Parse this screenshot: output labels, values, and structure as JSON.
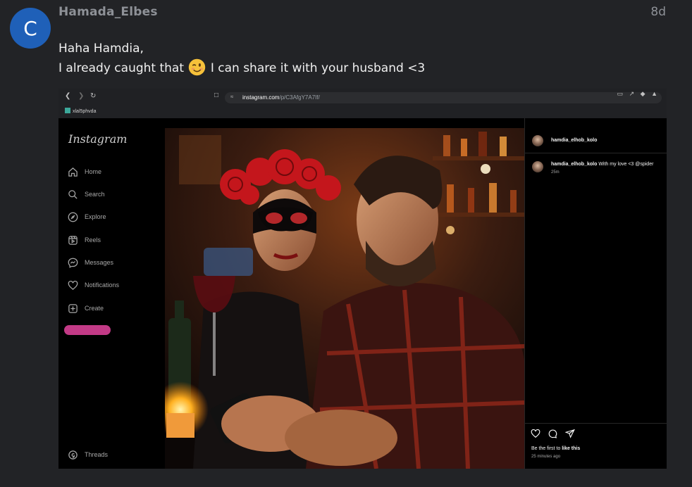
{
  "post": {
    "avatar_letter": "C",
    "username": "Hamada_Elbes",
    "age": "8d",
    "line1": "Haha Hamdia,",
    "line2_before": "I already caught that",
    "emoji": "winking-face",
    "line2_after": "I can share it with your husband <3"
  },
  "screenshot": {
    "url_host": "instagram.com",
    "url_path": "/p/C3AfgY7A7If/",
    "bookmark": "xlal5phvda",
    "logo": "Instagram",
    "nav": [
      {
        "label": "Home",
        "icon": "home-icon"
      },
      {
        "label": "Search",
        "icon": "search-icon"
      },
      {
        "label": "Explore",
        "icon": "compass-icon"
      },
      {
        "label": "Reels",
        "icon": "reels-icon"
      },
      {
        "label": "Messages",
        "icon": "messenger-icon"
      },
      {
        "label": "Notifications",
        "icon": "heart-icon"
      },
      {
        "label": "Create",
        "icon": "plus-icon"
      }
    ],
    "threads": "Threads",
    "panel": {
      "username": "hamdia_elhob_kolo",
      "comment_user": "hamdia_elhob_kolo",
      "comment_text": "With my love <3 @spider",
      "comment_time": "25m",
      "likes_prefix": "Be the first to ",
      "likes_bold": "like this",
      "posted": "25 minutes ago"
    }
  }
}
